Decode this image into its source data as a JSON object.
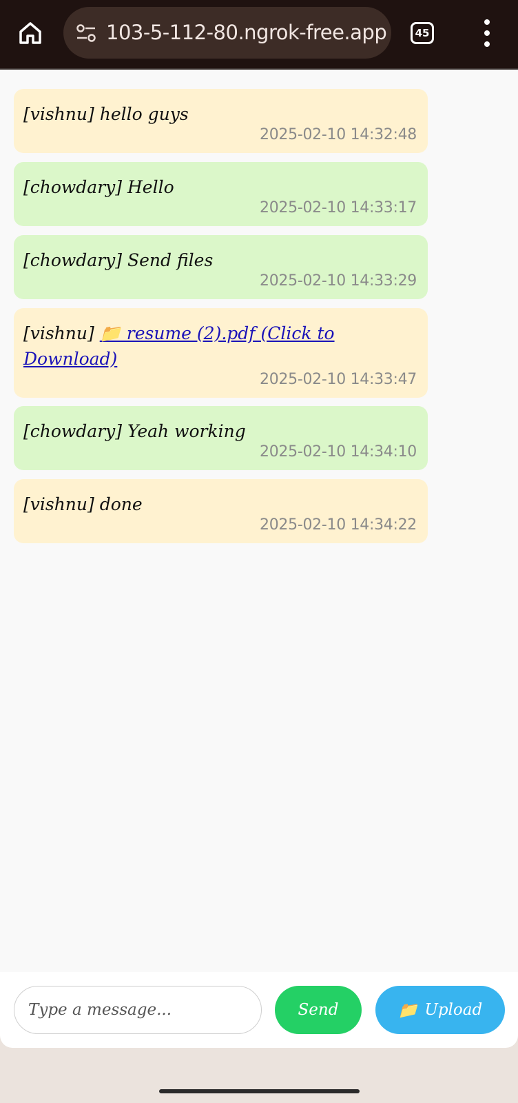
{
  "browser": {
    "url": "103-5-112-80.ngrok-free.app",
    "tab_count": "45"
  },
  "messages": [
    {
      "sender": "vishnu",
      "prefix": "[vishnu] ",
      "text": "hello guys",
      "time": "2025-02-10 14:32:48",
      "mine": true
    },
    {
      "sender": "chowdary",
      "prefix": "[chowdary] ",
      "text": "Hello",
      "time": "2025-02-10 14:33:17",
      "mine": false
    },
    {
      "sender": "chowdary",
      "prefix": "[chowdary] ",
      "text": "Send files",
      "time": "2025-02-10 14:33:29",
      "mine": false
    },
    {
      "sender": "vishnu",
      "prefix": "[vishnu] ",
      "link": "📁 resume (2).pdf (Click to Download)",
      "time": "2025-02-10 14:33:47",
      "mine": true
    },
    {
      "sender": "chowdary",
      "prefix": "[chowdary] ",
      "text": "Yeah working",
      "time": "2025-02-10 14:34:10",
      "mine": false
    },
    {
      "sender": "vishnu",
      "prefix": "[vishnu] ",
      "text": "done",
      "time": "2025-02-10 14:34:22",
      "mine": true
    }
  ],
  "composer": {
    "placeholder": "Type a message...",
    "send_label": "Send",
    "upload_icon": "📁",
    "upload_label": "Upload"
  },
  "colors": {
    "mine_bubble": "#fff2d0",
    "theirs_bubble": "#dbf7c9",
    "send_button": "#24d065",
    "upload_button": "#38b4ef",
    "link": "#1a12b8"
  }
}
